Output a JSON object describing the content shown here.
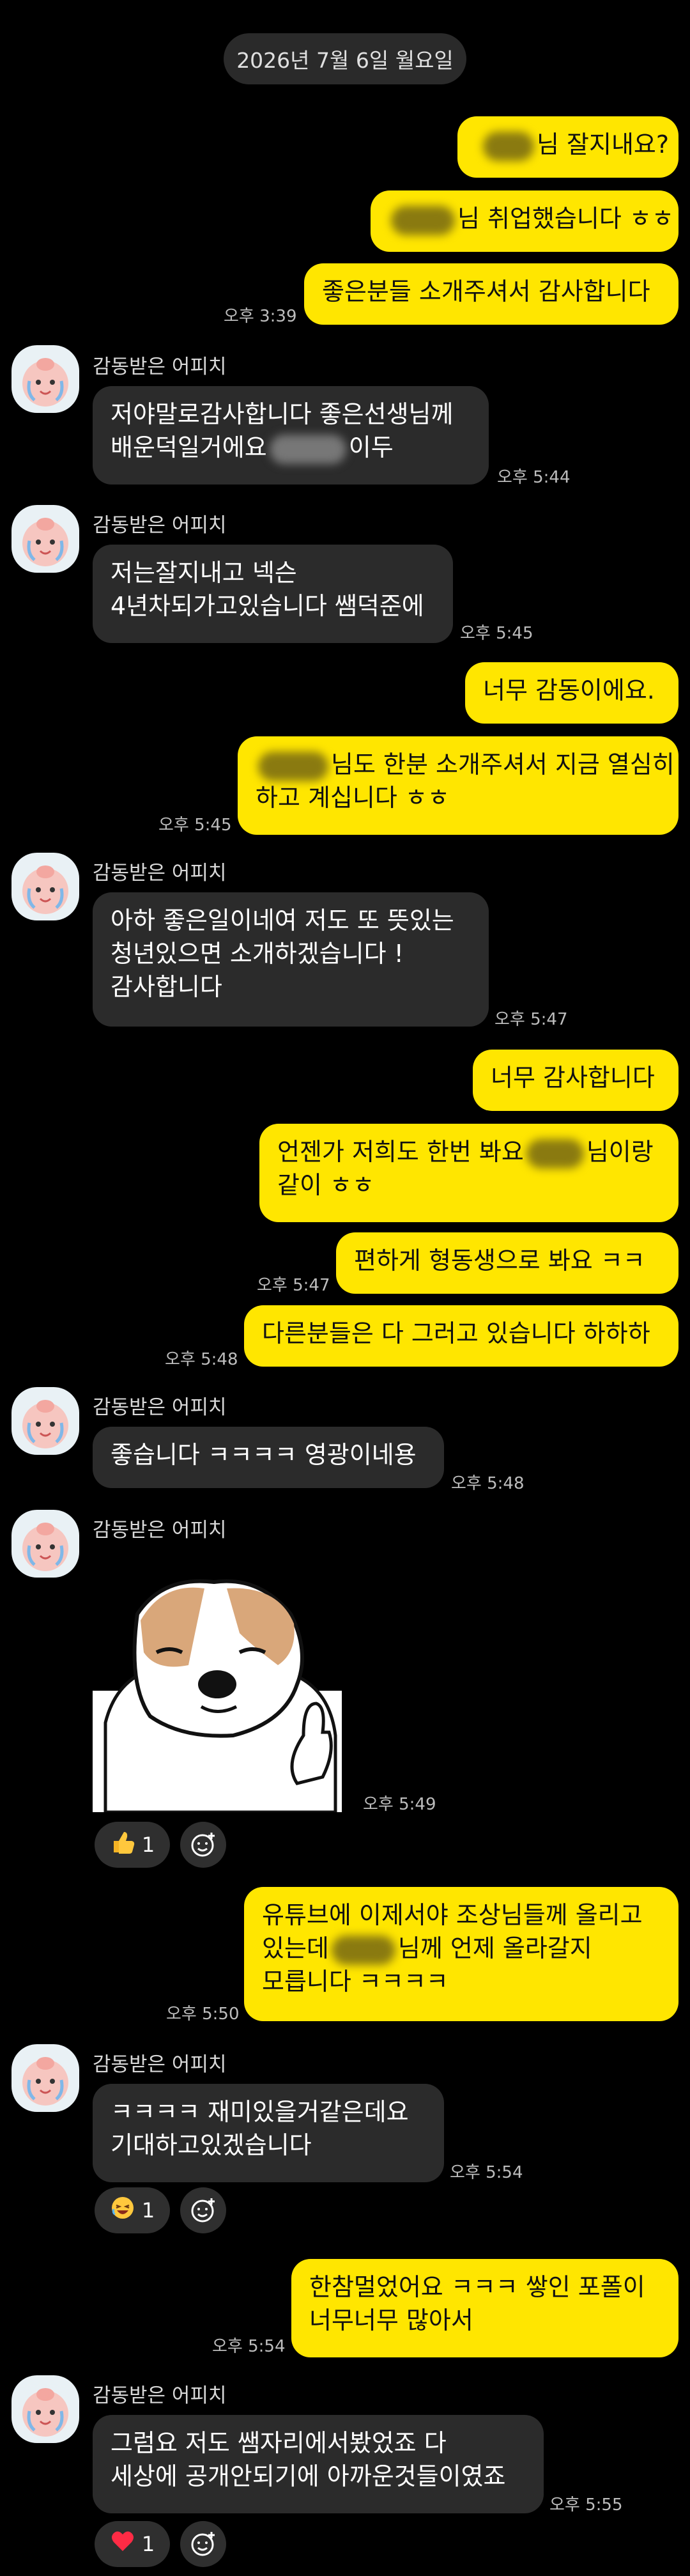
{
  "date_divider": "2026년 7월 6일 월요일",
  "sender_name": "감동받은 어피치",
  "messages": {
    "m1": "님 잘지내요?",
    "m2": "님 취업했습니다 ㅎㅎ",
    "m3": "좋은분들 소개주셔서 감사합니다",
    "t3": "오후 3:39",
    "r1a": "저야말로감사합니다 좋은선생님께",
    "r1b": "배운덕일거에요",
    "r1b2": "이두",
    "tr1": "오후 5:44",
    "r2a": "저는잘지내고 넥슨",
    "r2b": "4년차되가고있습니다 쌤덕준에",
    "tr2": "오후 5:45",
    "m4": "너무 감동이에요.",
    "m5a": "님도 한분 소개주셔서 지금 열심히",
    "m5b": "하고 계십니다 ㅎㅎ",
    "t5": "오후 5:45",
    "r3a": "아하 좋은일이네여 저도 또 뜻있는",
    "r3b": "청년있으면 소개하겠습니다 !",
    "r3c": "감사합니다",
    "tr3": "오후 5:47",
    "m6": "너무 감사합니다",
    "m7a": "언젠가 저희도 한번 봐요",
    "m7a2": "님이랑",
    "m7b": "같이 ㅎㅎ",
    "m8": "편하게 형동생으로 봐요 ㅋㅋ",
    "t8": "오후 5:47",
    "m9": "다른분들은 다 그러고 있습니다 하하하",
    "t9": "오후 5:48",
    "r4": "좋습니다 ㅋㅋㅋㅋ 영광이네용",
    "tr4": "오후 5:48",
    "tr5": "오후 5:49",
    "react1_count": "1",
    "m10a": "유튜브에 이제서야 조상님들께 올리고",
    "m10b": "있는데",
    "m10b2": "님께 언제 올라갈지",
    "m10c": "모릅니다 ㅋㅋㅋㅋ",
    "t10": "오후 5:50",
    "r6a": "ㅋㅋㅋㅋ 재미있을거같은데요",
    "r6b": "기대하고있겠습니다",
    "tr6": "오후 5:54",
    "react2_count": "1",
    "m11a": "한참멀었어요 ㅋㅋㅋ 쌓인 포폴이",
    "m11b": "너무너무 많아서",
    "t11": "오후 5:54",
    "r7a": "그럼요 저도 쌤자리에서봤었죠 다",
    "r7b": "세상에 공개안되기에 아까운것들이였죠",
    "tr7": "오후 5:55",
    "react3_count": "1"
  },
  "icons": {
    "reaction_thumbs": "thumbs-up-icon",
    "reaction_laugh": "laughing-face-icon",
    "reaction_heart": "heart-icon",
    "add_reaction": "add-reaction-icon",
    "avatar": "apeach-avatar-icon",
    "sticker": "dog-thumbs-up-sticker"
  },
  "colors": {
    "my_bubble": "#ffe600",
    "their_bubble": "#2b2b2b",
    "background": "#000000"
  }
}
